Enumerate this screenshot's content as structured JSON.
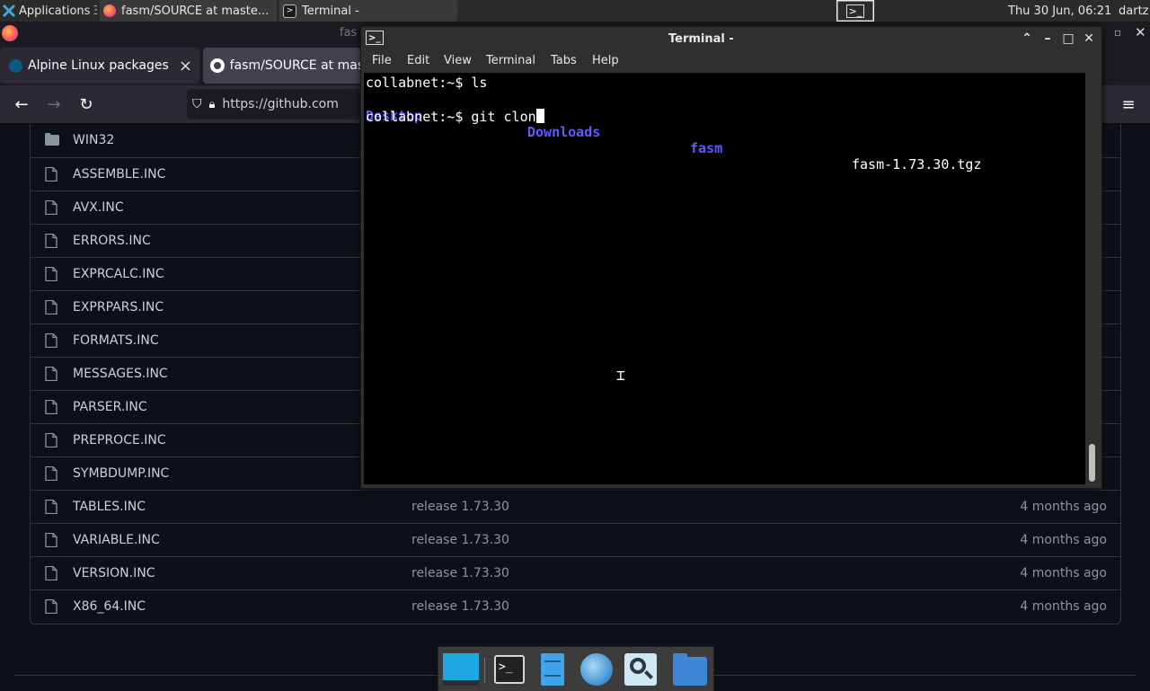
{
  "panel": {
    "applications_label": "Applications",
    "tasks": [
      {
        "label": "fasm/SOURCE at maste..."
      },
      {
        "label": "Terminal -"
      }
    ],
    "clock": "Thu 30 Jun, 06:21",
    "user": "dartz"
  },
  "firefox": {
    "window_title_fragment": "fas",
    "tabs": [
      {
        "label": "Alpine Linux packages"
      },
      {
        "label": "fasm/SOURCE at mas"
      }
    ],
    "url": "https://github.com",
    "tab_close_glyph": "×"
  },
  "github": {
    "files": [
      {
        "name": "WIN32",
        "type": "folder",
        "message": "",
        "age": ""
      },
      {
        "name": "ASSEMBLE.INC",
        "type": "file",
        "message": "",
        "age": ""
      },
      {
        "name": "AVX.INC",
        "type": "file",
        "message": "",
        "age": ""
      },
      {
        "name": "ERRORS.INC",
        "type": "file",
        "message": "",
        "age": ""
      },
      {
        "name": "EXPRCALC.INC",
        "type": "file",
        "message": "",
        "age": ""
      },
      {
        "name": "EXPRPARS.INC",
        "type": "file",
        "message": "",
        "age": ""
      },
      {
        "name": "FORMATS.INC",
        "type": "file",
        "message": "",
        "age": ""
      },
      {
        "name": "MESSAGES.INC",
        "type": "file",
        "message": "",
        "age": ""
      },
      {
        "name": "PARSER.INC",
        "type": "file",
        "message": "",
        "age": ""
      },
      {
        "name": "PREPROCE.INC",
        "type": "file",
        "message": "",
        "age": ""
      },
      {
        "name": "SYMBDUMP.INC",
        "type": "file",
        "message": "",
        "age": ""
      },
      {
        "name": "TABLES.INC",
        "type": "file",
        "message": "release 1.73.30",
        "age": "4 months ago"
      },
      {
        "name": "VARIABLE.INC",
        "type": "file",
        "message": "release 1.73.30",
        "age": "4 months ago"
      },
      {
        "name": "VERSION.INC",
        "type": "file",
        "message": "release 1.73.30",
        "age": "4 months ago"
      },
      {
        "name": "X86_64.INC",
        "type": "file",
        "message": "release 1.73.30",
        "age": "4 months ago"
      }
    ]
  },
  "terminal": {
    "title": "Terminal -",
    "menu": [
      "File",
      "Edit",
      "View",
      "Terminal",
      "Tabs",
      "Help"
    ],
    "lines": {
      "prompt1": "collabnet:~$ ls",
      "ls_desktop": "Desktop",
      "ls_downloads": "Downloads",
      "ls_fasm": "fasm",
      "ls_tgz": "fasm-1.73.30.tgz",
      "prompt2": "collabnet:~$ git clon"
    },
    "colors": {
      "directory": "#5c5cff",
      "background": "#000000",
      "text": "#ffffff"
    }
  },
  "dock": {
    "items": [
      "desktop-icon",
      "terminal-icon",
      "file-cabinet-icon",
      "web-browser-icon",
      "search-icon",
      "folder-icon"
    ]
  }
}
